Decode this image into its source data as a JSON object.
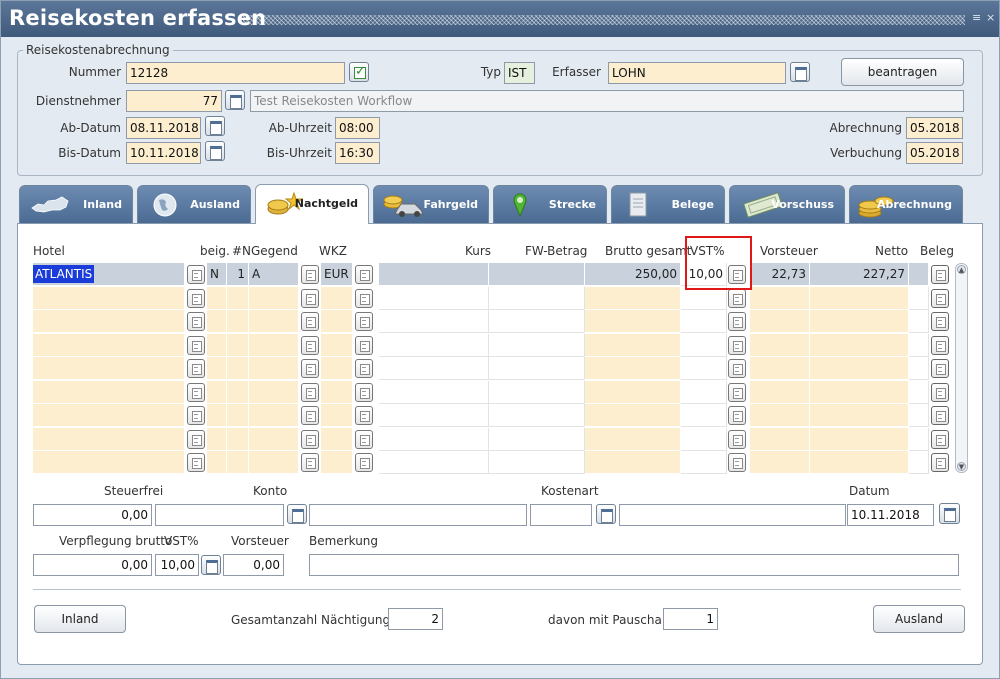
{
  "window": {
    "title": "Reisekosten erfassen"
  },
  "header": {
    "group_label": "Reisekostenabrechnung",
    "nummer_label": "Nummer",
    "nummer": "12128",
    "typ_label": "Typ",
    "typ": "IST",
    "erfasser_label": "Erfasser",
    "erfasser": "LOHN",
    "beantragen": "beantragen",
    "dienstnehmer_label": "Dienstnehmer",
    "dienstnehmer_nr": "77",
    "dienstnehmer_name": "Test Reisekosten Workflow",
    "ab_datum_label": "Ab-Datum",
    "ab_datum": "08.11.2018",
    "ab_uhrzeit_label": "Ab-Uhrzeit",
    "ab_uhrzeit": "08:00",
    "bis_datum_label": "Bis-Datum",
    "bis_datum": "10.11.2018",
    "bis_uhrzeit_label": "Bis-Uhrzeit",
    "bis_uhrzeit": "16:30",
    "abrechnung_label": "Abrechnung",
    "abrechnung": "05.2018",
    "verbuchung_label": "Verbuchung",
    "verbuchung": "05.2018"
  },
  "tabs": [
    {
      "label": "Inland",
      "icon": "austria-map-icon"
    },
    {
      "label": "Ausland",
      "icon": "globe-icon"
    },
    {
      "label": "Nachtgeld",
      "icon": "coins-stars-icon",
      "active": true
    },
    {
      "label": "Fahrgeld",
      "icon": "car-coins-icon"
    },
    {
      "label": "Strecke",
      "icon": "map-pin-icon"
    },
    {
      "label": "Belege",
      "icon": "document-icon"
    },
    {
      "label": "Vorschuss",
      "icon": "money-icon"
    },
    {
      "label": "Abrechnung",
      "icon": "coin-stack-icon"
    }
  ],
  "table": {
    "headers": {
      "hotel": "Hotel",
      "beig": "beig.",
      "n": "#N",
      "gegend": "Gegend",
      "wkz": "WKZ",
      "kurs": "Kurs",
      "fw": "FW-Betrag",
      "brutto": "Brutto gesamt",
      "vst": "VST%",
      "vorsteuer": "Vorsteuer",
      "netto": "Netto",
      "beleg": "Beleg"
    },
    "row1": {
      "hotel": "ATLANTIS",
      "beig": "N",
      "n": "1",
      "gegend": "A",
      "wkz": "EUR",
      "brutto": "250,00",
      "vst": "10,00",
      "vorsteuer": "22,73",
      "netto": "227,27"
    }
  },
  "details": {
    "steuerfrei_label": "Steuerfrei",
    "steuerfrei": "0,00",
    "konto_label": "Konto",
    "kostenart_label": "Kostenart",
    "datum_label": "Datum",
    "datum": "10.11.2018",
    "verpflegung_label": "Verpflegung brutto",
    "verpflegung": "0,00",
    "vst_label": "VST%",
    "vst": "10,00",
    "vorsteuer_label": "Vorsteuer",
    "vorsteuer": "0,00",
    "bemerkung_label": "Bemerkung"
  },
  "footer": {
    "inland": "Inland",
    "gesamt_label": "Gesamtanzahl Nächtigungen",
    "gesamt": "2",
    "pauschale_label": "davon mit Pauschale",
    "pauschale": "1",
    "ausland": "Ausland"
  }
}
